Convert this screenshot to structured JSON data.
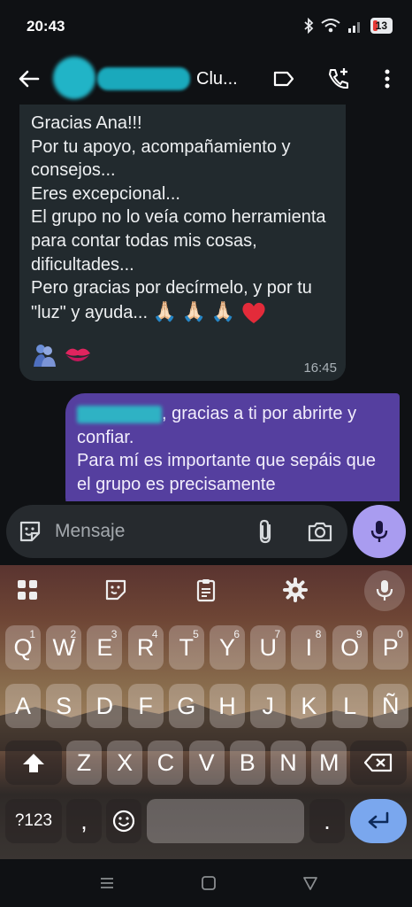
{
  "status": {
    "time": "20:43",
    "battery": "13"
  },
  "appbar": {
    "title": "Clu..."
  },
  "messages": {
    "incoming": {
      "text": "Gracias Ana!!!\nPor tu apoyo, acompañamiento y consejos...\nEres excepcional...\nEl grupo no lo veía como herramienta para contar todas mis cosas, dificultades...\nPero gracias por decírmelo, y por tu \"luz\" y ayuda...",
      "emoji_inline": [
        "🙏🏻",
        "🙏🏻",
        "🙏🏻"
      ],
      "emoji_row": [
        "🫂",
        "💋"
      ],
      "time": "16:45"
    },
    "outgoing": {
      "text_after_name": ", gracias a ti por abrirte y confiar.",
      "text_line2": "Para mí es importante que sepáis que el grupo es precisamente"
    }
  },
  "composer": {
    "placeholder": "Mensaje"
  },
  "keyboard": {
    "row1": [
      {
        "k": "Q",
        "h": "1"
      },
      {
        "k": "W",
        "h": "2"
      },
      {
        "k": "E",
        "h": "3"
      },
      {
        "k": "R",
        "h": "4"
      },
      {
        "k": "T",
        "h": "5"
      },
      {
        "k": "Y",
        "h": "6"
      },
      {
        "k": "U",
        "h": "7"
      },
      {
        "k": "I",
        "h": "8"
      },
      {
        "k": "O",
        "h": "9"
      },
      {
        "k": "P",
        "h": "0"
      }
    ],
    "row2": [
      "A",
      "S",
      "D",
      "F",
      "G",
      "H",
      "J",
      "K",
      "L",
      "Ñ"
    ],
    "row3": [
      "Z",
      "X",
      "C",
      "V",
      "B",
      "N",
      "M"
    ],
    "symbols_label": "?123",
    "comma": ",",
    "period": "."
  },
  "colors": {
    "incoming_bubble": "#222a2e",
    "outgoing_bubble": "#553f9f",
    "mic_button": "#a99cf0",
    "enter_key": "#7aa7ee"
  }
}
